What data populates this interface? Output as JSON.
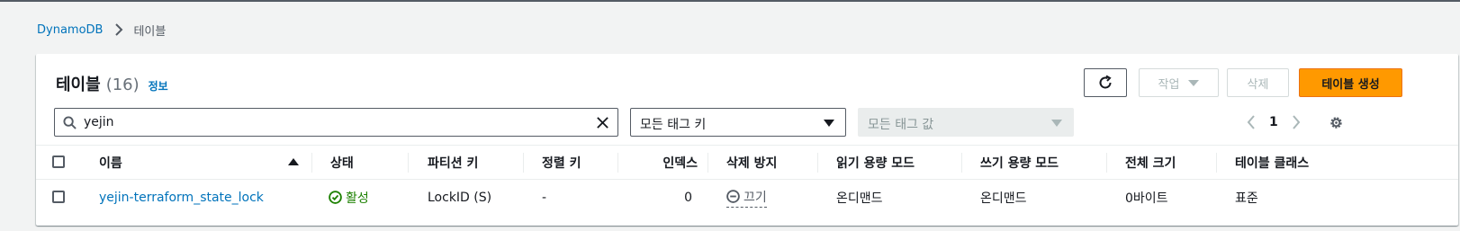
{
  "breadcrumb": {
    "root": "DynamoDB",
    "current": "테이블"
  },
  "header": {
    "title": "테이블",
    "count": "(16)",
    "info": "정보"
  },
  "toolbar": {
    "refresh_icon": "refresh-icon",
    "actions_label": "작업",
    "delete_label": "삭제",
    "create_label": "테이블 생성"
  },
  "filters": {
    "search_value": "yejin",
    "tag_keys": "모든 태그 키",
    "tag_values": "모든 태그 값"
  },
  "pagination": {
    "page": "1"
  },
  "table": {
    "columns": [
      "이름",
      "상태",
      "파티션 키",
      "정렬 키",
      "인덱스",
      "삭제 방지",
      "읽기 용량 모드",
      "쓰기 용량 모드",
      "전체 크기",
      "테이블 클래스"
    ],
    "rows": [
      {
        "name": "yejin-terraform_state_lock",
        "status": "활성",
        "partition_key": "LockID (S)",
        "sort_key": "-",
        "indexes": "0",
        "deletion_protection": "끄기",
        "read_mode": "온디맨드",
        "write_mode": "온디맨드",
        "size": "0바이트",
        "table_class": "표준"
      }
    ]
  },
  "colors": {
    "accent": "#0073bb",
    "primary_button": "#ff9900",
    "success": "#1d8102"
  }
}
